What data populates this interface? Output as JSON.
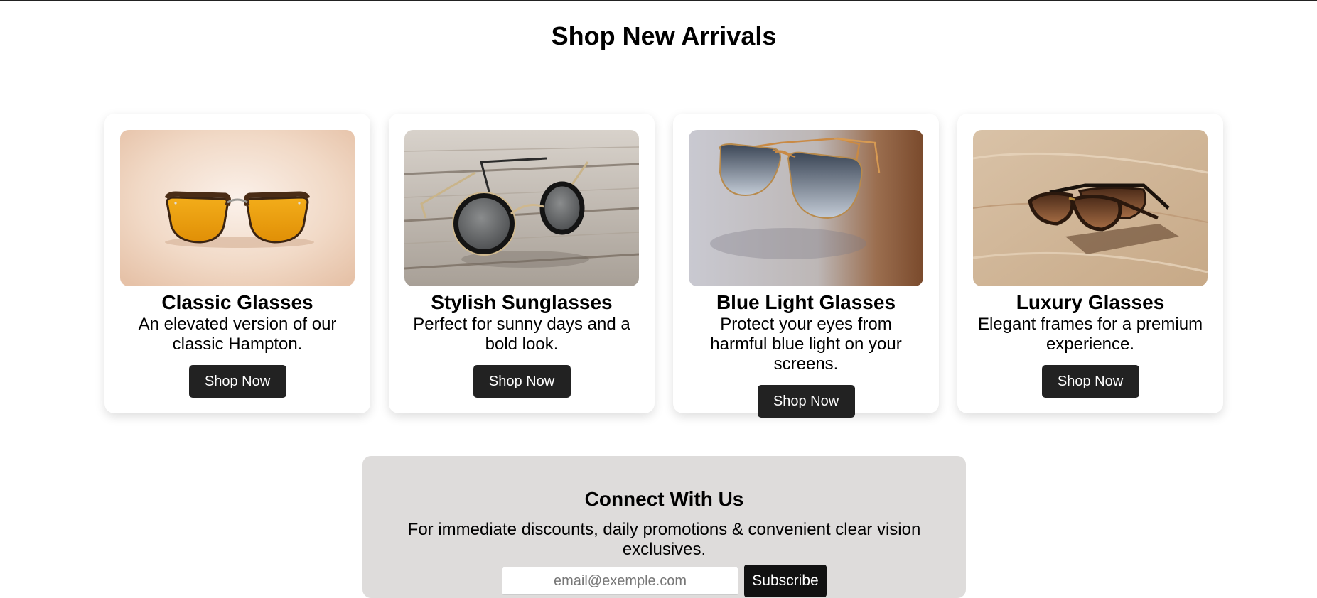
{
  "page": {
    "title": "Shop New Arrivals"
  },
  "products": [
    {
      "title": "Classic Glasses",
      "description": "An elevated version of our classic Hampton.",
      "button_label": "Shop Now",
      "image_icon": "classic-glasses-image"
    },
    {
      "title": "Stylish Sunglasses",
      "description": "Perfect for sunny days and a bold look.",
      "button_label": "Shop Now",
      "image_icon": "round-sunglasses-image"
    },
    {
      "title": "Blue Light Glasses",
      "description": "Protect your eyes from harmful blue light on your screens.",
      "button_label": "Shop Now",
      "image_icon": "aviator-glasses-image"
    },
    {
      "title": "Luxury Glasses",
      "description": "Elegant frames for a premium experience.",
      "button_label": "Shop Now",
      "image_icon": "luxury-sunglasses-image"
    }
  ],
  "connect": {
    "title": "Connect With Us",
    "text": "For immediate discounts, daily promotions & convenient clear vision exclusives.",
    "email_placeholder": "email@exemple.com",
    "subscribe_label": "Subscribe"
  },
  "colors": {
    "button_bg": "#222222",
    "connect_bg": "#dedcdb"
  }
}
